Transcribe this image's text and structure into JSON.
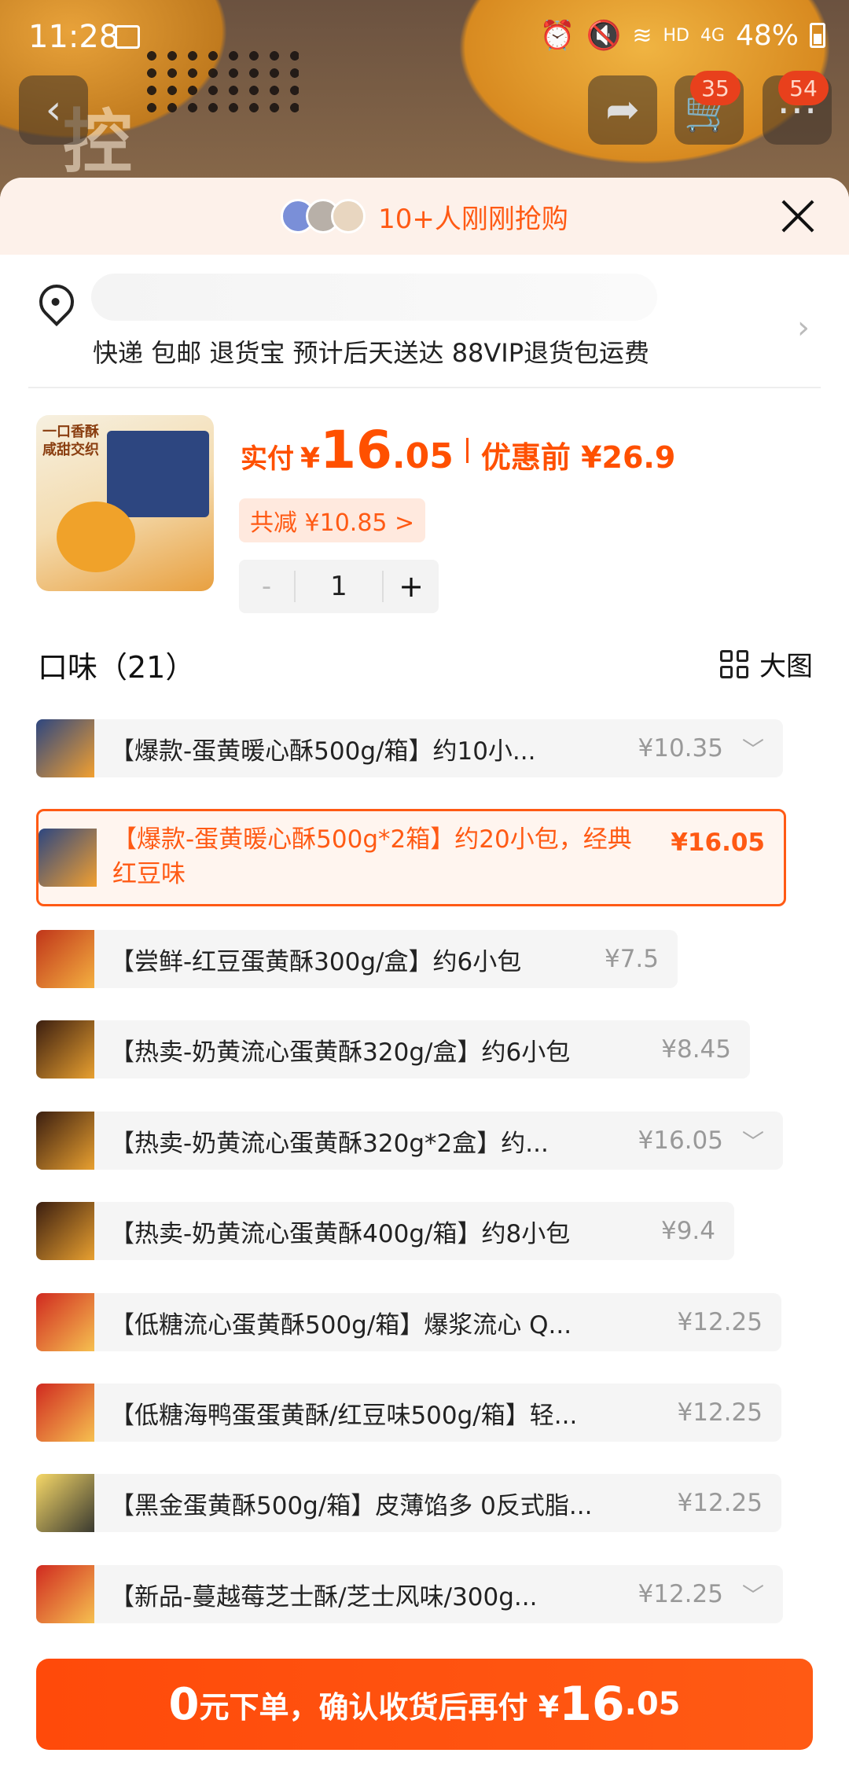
{
  "status_bar": {
    "time": "11:28",
    "network": "HD",
    "signal": "4G",
    "battery": "48%"
  },
  "nav": {
    "cart_badge": "35",
    "more_badge": "54"
  },
  "background": {
    "stamp_text": "控"
  },
  "sheet": {
    "header_text": "10+人刚刚抢购",
    "delivery_line": "快递 包邮 退货宝 预计后天送达 88VIP退货包运费"
  },
  "product": {
    "thumb_text": "一口香酥 咸甜交织",
    "price_prefix": "实付",
    "currency": "¥",
    "price_int": "16",
    "price_dec": ".05",
    "price_before": "优惠前 ¥26.9",
    "coupon": "共减 ¥10.85 >",
    "quantity": "1",
    "minus": "-",
    "plus": "+"
  },
  "flavor": {
    "title": "口味（21）",
    "big_view": "大图",
    "options": [
      {
        "name": "【爆款-蛋黄暖心酥500g/箱】约10小...",
        "price": "¥10.35",
        "chevron": "﹀"
      },
      {
        "name": "【爆款-蛋黄暖心酥500g*2箱】约20小包，经典红豆味",
        "price": "¥16.05",
        "chevron": ""
      },
      {
        "name": "【尝鲜-红豆蛋黄酥300g/盒】约6小包",
        "price": "¥7.5",
        "chevron": ""
      },
      {
        "name": "【热卖-奶黄流心蛋黄酥320g/盒】约6小包",
        "price": "¥8.45",
        "chevron": ""
      },
      {
        "name": "【热卖-奶黄流心蛋黄酥320g*2盒】约...",
        "price": "¥16.05",
        "chevron": "﹀"
      },
      {
        "name": "【热卖-奶黄流心蛋黄酥400g/箱】约8小包",
        "price": "¥9.4",
        "chevron": ""
      },
      {
        "name": "【低糖流心蛋黄酥500g/箱】爆浆流心 Q...",
        "price": "¥12.25",
        "chevron": ""
      },
      {
        "name": "【低糖海鸭蛋蛋黄酥/红豆味500g/箱】轻...",
        "price": "¥12.25",
        "chevron": ""
      },
      {
        "name": "【黑金蛋黄酥500g/箱】皮薄馅多 0反式脂...",
        "price": "¥12.25",
        "chevron": ""
      },
      {
        "name": "【新品-蔓越莓芝士酥/芝士风味/300g...",
        "price": "¥12.25",
        "chevron": "﹀"
      }
    ]
  },
  "cta": {
    "zero": "0",
    "mid": "元下单，确认收货后再付 ¥",
    "int": "16",
    "dec": ".05"
  },
  "colors": {
    "accent": "#ff5000",
    "sheet_header_bg": "#fdf1ea"
  }
}
